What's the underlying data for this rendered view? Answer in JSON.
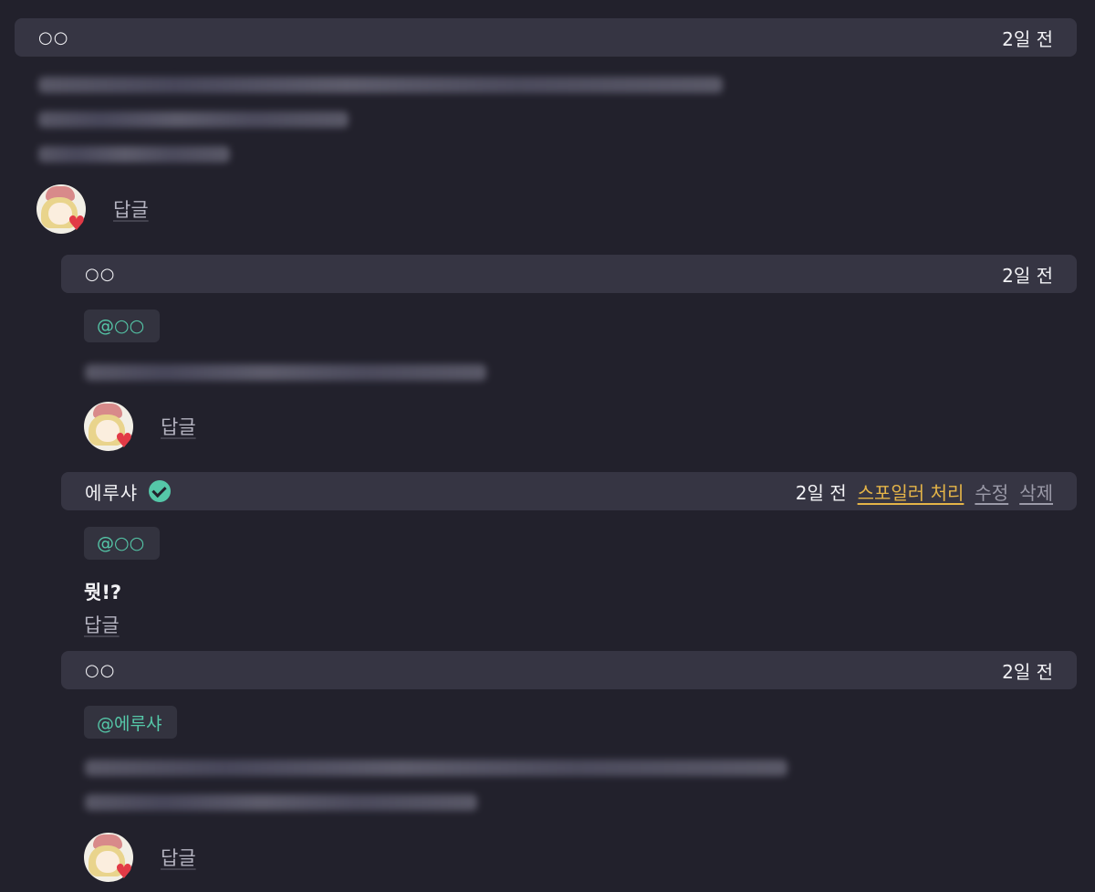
{
  "comments": [
    {
      "author": "○○",
      "time": "2일 전",
      "reply_label": "답글"
    },
    {
      "author": "○○",
      "time": "2일 전",
      "mention": "@○○",
      "reply_label": "답글"
    },
    {
      "author": "에루샤",
      "time": "2일 전",
      "actions": {
        "spoiler": "스포일러 처리",
        "edit": "수정",
        "delete": "삭제"
      },
      "mention": "@○○",
      "body": "뭣!?",
      "reply_label": "답글"
    },
    {
      "author": "○○",
      "time": "2일 전",
      "mention": "@에루샤",
      "reply_label": "답글"
    }
  ],
  "colors": {
    "background": "#22212c",
    "bar": "#363543",
    "mention": "#55c7a8",
    "spoiler": "#e4b448",
    "verified": "#55c7a8"
  },
  "icons": {
    "verified": "verified-check-icon",
    "avatar": "user-avatar-icon"
  }
}
